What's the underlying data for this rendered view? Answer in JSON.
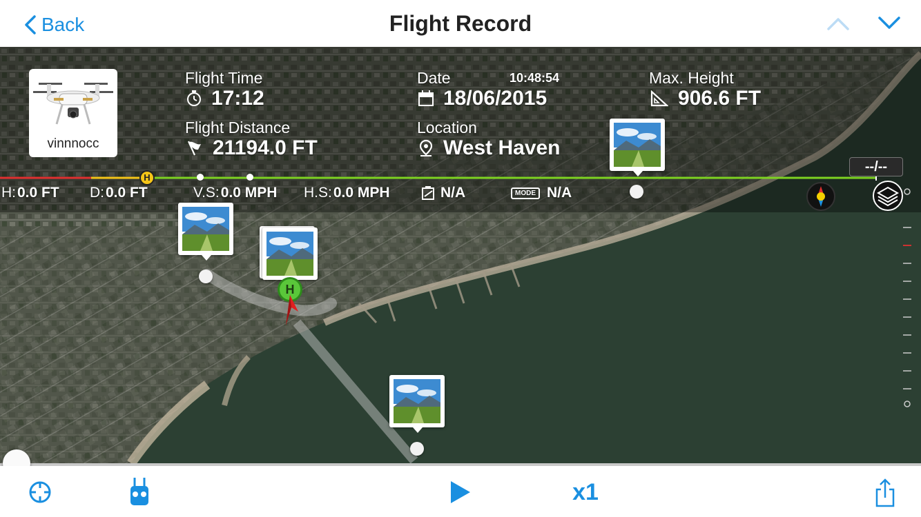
{
  "header": {
    "back_label": "Back",
    "title": "Flight Record"
  },
  "summary": {
    "username": "vinnnocc",
    "flight_time_label": "Flight Time",
    "flight_time": "17:12",
    "date_label": "Date",
    "time_of_day": "10:48:54",
    "date": "18/06/2015",
    "max_height_label": "Max. Height",
    "max_height": "906.6 FT",
    "flight_distance_label": "Flight Distance",
    "flight_distance": "21194.0 FT",
    "location_label": "Location",
    "location": "West Haven"
  },
  "timeline": {
    "time_readout": "--/--",
    "home_marker": "H"
  },
  "telemetry": {
    "h_key": "H:",
    "h_val": "0.0 FT",
    "d_key": "D:",
    "d_val": "0.0 FT",
    "vs_key": "V.S:",
    "vs_val": "0.0 MPH",
    "hs_key": "H.S:",
    "hs_val": "0.0 MPH",
    "battery_val": "N/A",
    "mode_badge": "MODE",
    "mode_val": "N/A"
  },
  "map": {
    "home_pin_label": "H"
  },
  "playback": {
    "speed": "x1",
    "progress": 0
  },
  "icons": [
    "chevron-left-icon",
    "chevron-up-icon",
    "chevron-down-icon",
    "stopwatch-icon",
    "calendar-icon",
    "ruler-triangle-icon",
    "flag-icon",
    "location-pin-icon",
    "battery-icon",
    "compass-icon",
    "layers-icon",
    "crosshair-icon",
    "remote-controller-icon",
    "play-icon",
    "share-icon"
  ],
  "colors": {
    "accent": "#1a8fe0",
    "track_green": "#7ed321",
    "track_red": "#e03030",
    "track_yellow": "#f5c518"
  }
}
